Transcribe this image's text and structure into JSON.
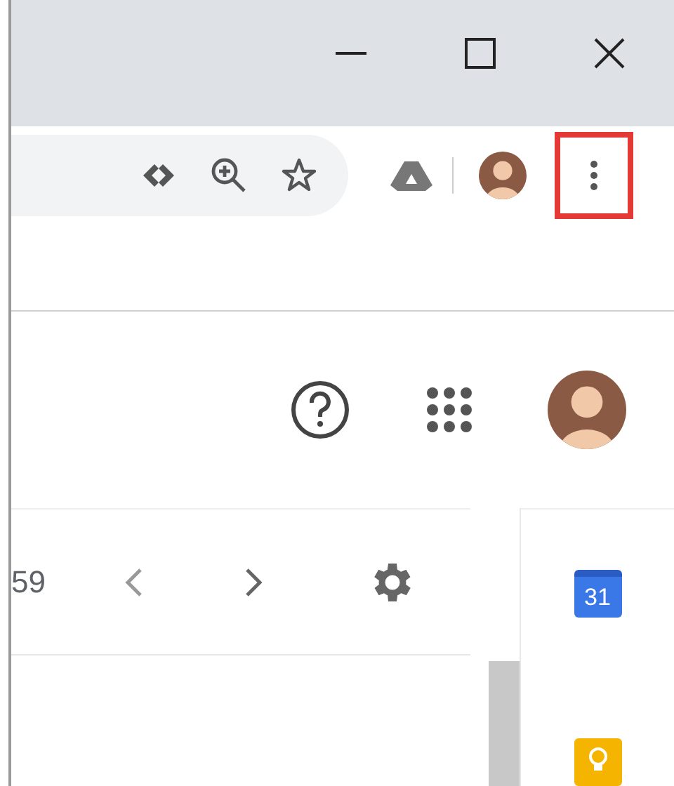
{
  "browser": {
    "menu_button": {
      "highlighted": true
    }
  },
  "mail_toolbar": {
    "page_count": "59"
  },
  "side_panel": {
    "calendar_day": "31"
  }
}
